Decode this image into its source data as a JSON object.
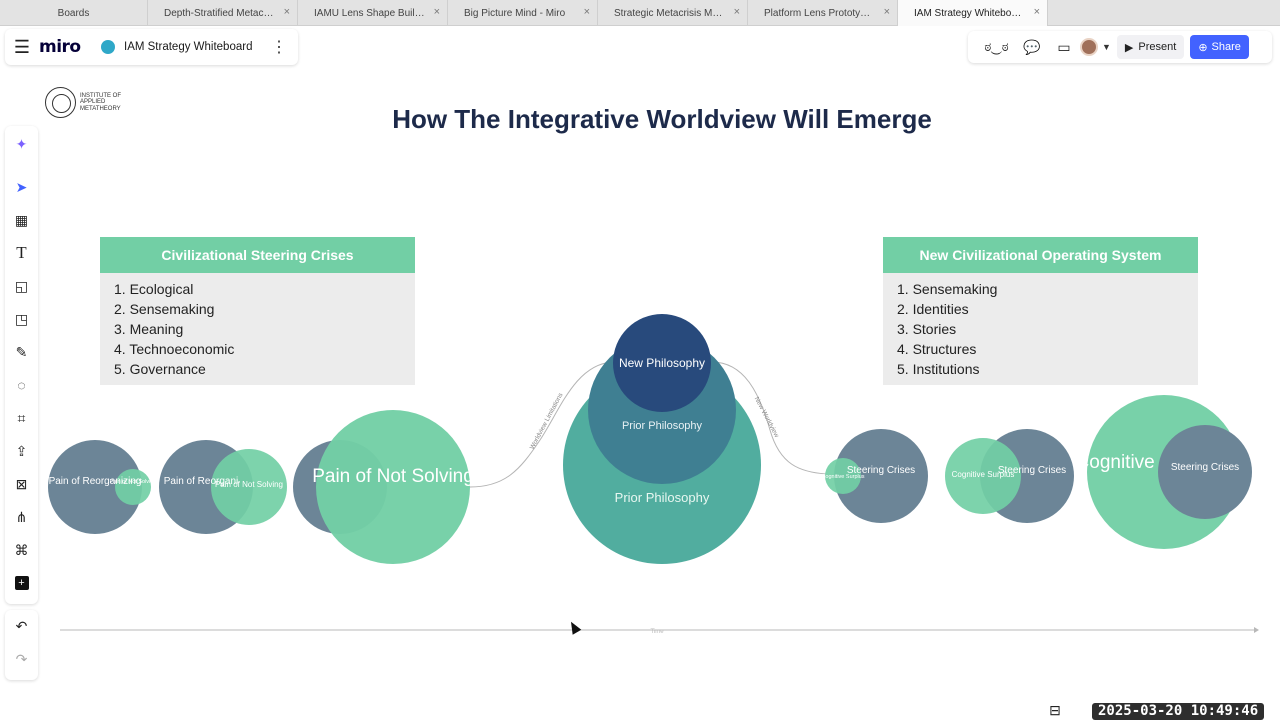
{
  "browser_tabs": [
    {
      "label": "Boards",
      "active": false,
      "closable": false
    },
    {
      "label": "Depth-Stratified Metacrisi...",
      "active": false,
      "closable": true
    },
    {
      "label": "IAMU Lens Shape Builder...",
      "active": false,
      "closable": true
    },
    {
      "label": "Big Picture Mind - Miro",
      "active": false,
      "closable": true
    },
    {
      "label": "Strategic Metacrisis Mapp...",
      "active": false,
      "closable": true
    },
    {
      "label": "Platform Lens Prototype - ...",
      "active": false,
      "closable": true
    },
    {
      "label": "IAM Strategy Whiteboard ...",
      "active": true,
      "closable": true
    }
  ],
  "topbar": {
    "logo": "miro",
    "board_title": "IAM Strategy Whiteboard",
    "present_label": "Present",
    "share_label": "Share"
  },
  "toolbar_icons": [
    "sparkle-icon",
    "select-icon",
    "template-icon",
    "text-icon",
    "sticky-note-icon",
    "shapes-icon",
    "pen-icon",
    "comment-icon",
    "frame-icon",
    "upload-icon",
    "apps-icon",
    "mindmap-icon",
    "connector-icon",
    "add-icon"
  ],
  "canvas": {
    "logo_text": "INSTITUTE OF APPLIED METATHEORY",
    "title": "How The Integrative Worldview Will Emerge",
    "left_card": {
      "header": "Civilizational Steering Crises",
      "items": [
        "1. Ecological",
        "2. Sensemaking",
        "3. Meaning",
        "4. Technoeconomic",
        "5. Governance"
      ]
    },
    "right_card": {
      "header": "New Civilizational Operating System",
      "items": [
        "1. Sensemaking",
        "2. Identities",
        "3. Stories",
        "4. Structures",
        "5. Institutions"
      ]
    },
    "circles": {
      "pain_reorg": "Pain of Reorganizing",
      "pain_reorg_short": "Pain of Reorgani",
      "pain_not_solving_small": "Pain of Not Solving",
      "pain_not_solving": "Pain of Not Solving",
      "new_philosophy": "New Philosophy",
      "prior_philosophy": "Prior Philosophy",
      "steering_crises": "Steering Crises",
      "cognitive_surplus": "Cognitive Surplus",
      "cognitive_surplus_big": "Cognitive Surplus"
    },
    "arrows": {
      "left": "Worldview Limitations",
      "right": "New Worldview"
    },
    "timeline_label": "Time"
  },
  "timestamp": "2025-03-20 10:49:46",
  "colors": {
    "teal_green": "#72cfa5",
    "slate": "#6c8597",
    "navy": "#284a7c",
    "title": "#1d2a4a",
    "brand_blue": "#4262ff"
  }
}
